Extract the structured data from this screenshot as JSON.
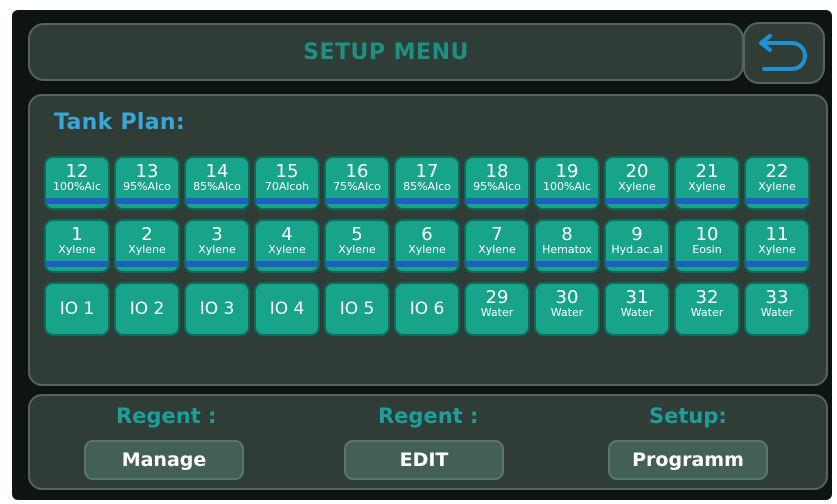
{
  "header": {
    "title": "SETUP MENU",
    "back_icon": "back-arrow-icon"
  },
  "tank_plan": {
    "title": "Tank Plan:",
    "rows": [
      [
        {
          "num": "12",
          "name": "100%Alc"
        },
        {
          "num": "13",
          "name": "95%Alco"
        },
        {
          "num": "14",
          "name": "85%Alco"
        },
        {
          "num": "15",
          "name": "70Alcoh"
        },
        {
          "num": "16",
          "name": "75%Alco"
        },
        {
          "num": "17",
          "name": "85%Alco"
        },
        {
          "num": "18",
          "name": "95%Alco"
        },
        {
          "num": "19",
          "name": "100%Alc"
        },
        {
          "num": "20",
          "name": "Xylene"
        },
        {
          "num": "21",
          "name": "Xylene"
        },
        {
          "num": "22",
          "name": "Xylene"
        }
      ],
      [
        {
          "num": "1",
          "name": "Xylene"
        },
        {
          "num": "2",
          "name": "Xylene"
        },
        {
          "num": "3",
          "name": "Xylene"
        },
        {
          "num": "4",
          "name": "Xylene"
        },
        {
          "num": "5",
          "name": "Xylene"
        },
        {
          "num": "6",
          "name": "Xylene"
        },
        {
          "num": "7",
          "name": "Xylene"
        },
        {
          "num": "8",
          "name": "Hematox"
        },
        {
          "num": "9",
          "name": "Hyd.ac.al"
        },
        {
          "num": "10",
          "name": "Eosin"
        },
        {
          "num": "11",
          "name": "Xylene"
        }
      ],
      [
        {
          "label": "IO 1"
        },
        {
          "label": "IO 2"
        },
        {
          "label": "IO 3"
        },
        {
          "label": "IO 4"
        },
        {
          "label": "IO 5"
        },
        {
          "label": "IO 6"
        },
        {
          "num": "29",
          "name": "Water"
        },
        {
          "num": "30",
          "name": "Water"
        },
        {
          "num": "31",
          "name": "Water"
        },
        {
          "num": "32",
          "name": "Water"
        },
        {
          "num": "33",
          "name": "Water"
        }
      ]
    ]
  },
  "footer": {
    "sections": [
      {
        "label": "Regent :",
        "button": "Manage"
      },
      {
        "label": "Regent :",
        "button": "EDIT"
      },
      {
        "label": "Setup:",
        "button": "Programm"
      }
    ]
  },
  "colors": {
    "tank": "#17a48a",
    "level_bar": "#1f5fbf",
    "title_blue": "#3aa7d6",
    "header_text": "#1e8f84"
  }
}
